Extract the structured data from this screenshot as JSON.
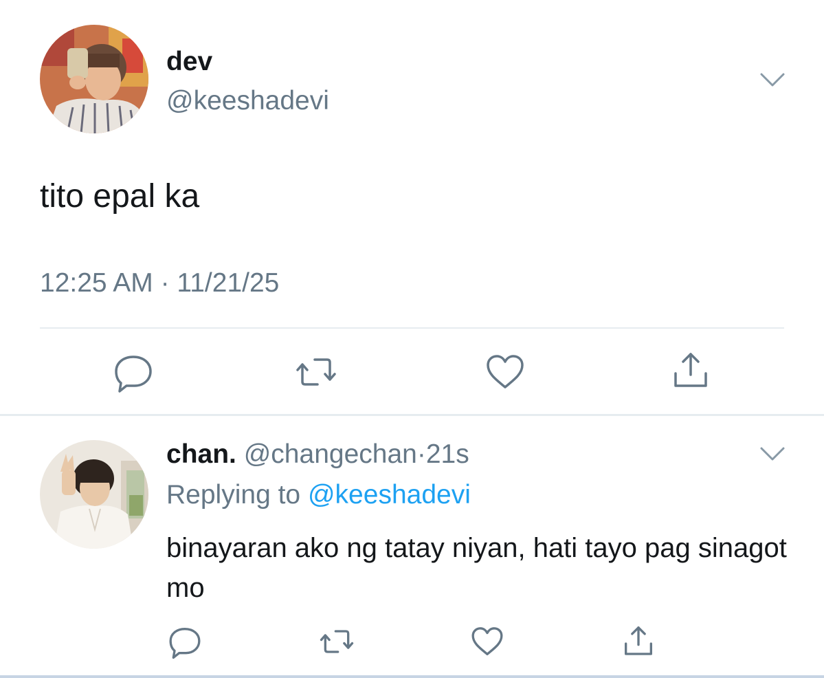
{
  "main_tweet": {
    "display_name": "dev",
    "handle": "@keeshadevi",
    "text": "tito epal ka",
    "timestamp": "12:25 AM · 11/21/25",
    "actions": [
      "reply-icon",
      "retweet-icon",
      "like-icon",
      "share-icon"
    ]
  },
  "reply_tweet": {
    "display_name": "chan.",
    "handle": "@changechan",
    "separator": "·",
    "time_ago": "21s",
    "replying_label": "Replying to",
    "replying_to": "@keeshadevi",
    "text": "binayaran ako ng tatay niyan, hati tayo pag sinagot mo",
    "actions": [
      "reply-icon",
      "retweet-icon",
      "like-icon",
      "share-icon"
    ]
  },
  "colors": {
    "primary_text": "#14171a",
    "secondary_text": "#657786",
    "link": "#1da1f2",
    "divider": "#e6ecf0"
  }
}
